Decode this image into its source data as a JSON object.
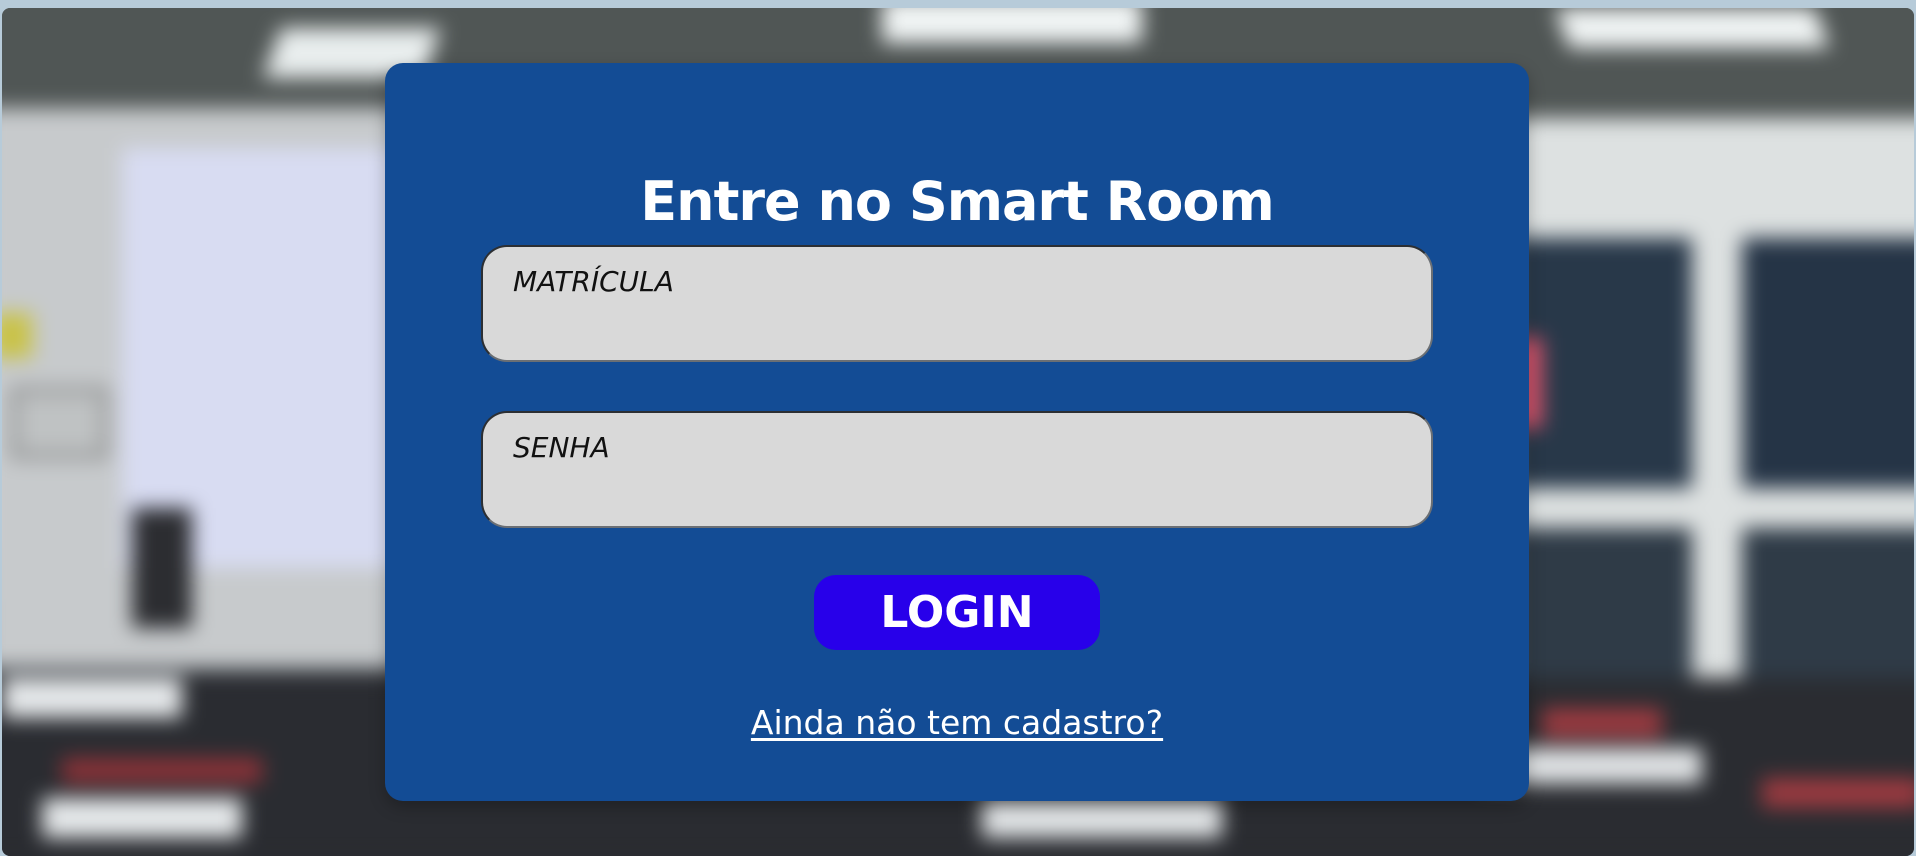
{
  "page": {
    "title": "Entre no Smart Room"
  },
  "form": {
    "username": {
      "placeholder": "MATRÍCULA",
      "value": ""
    },
    "password": {
      "placeholder": "SENHA",
      "value": ""
    },
    "login_label": "LOGIN",
    "register_link": "Ainda não tem cadastro?"
  },
  "colors": {
    "card_background": "#134c95",
    "login_button": "#2800ea",
    "input_background": "#d9d9d9",
    "text_on_card": "#ffffff"
  }
}
